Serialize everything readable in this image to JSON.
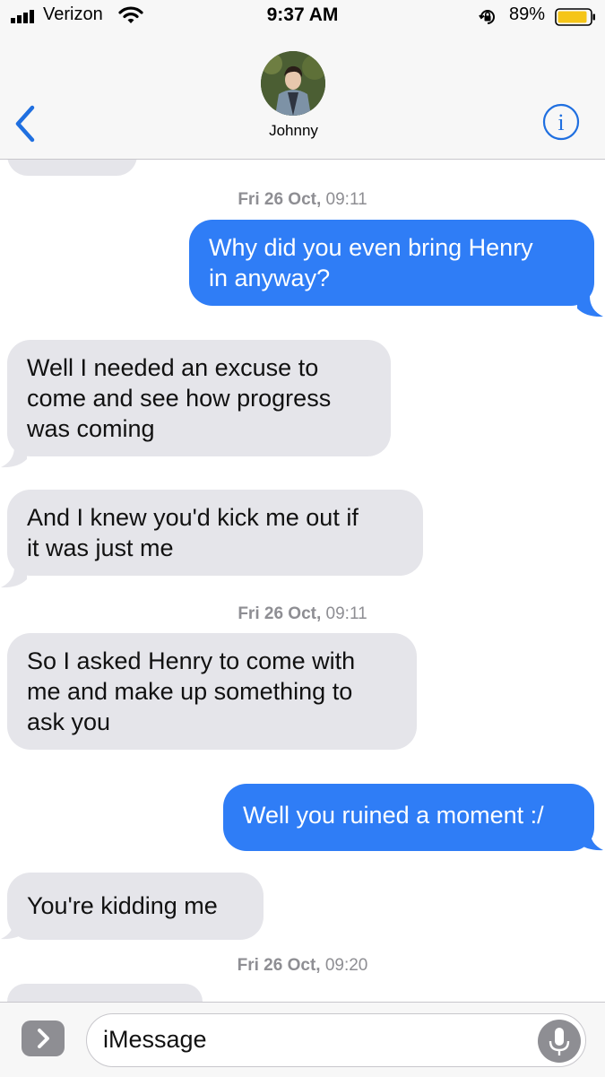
{
  "status_bar": {
    "carrier": "Verizon",
    "time": "9:37 AM",
    "battery_percent": "89%"
  },
  "header": {
    "contact_name": "Johnny"
  },
  "messages": [
    {
      "kind": "timestamp",
      "day": "Fri 26 Oct,",
      "time": "09:11"
    },
    {
      "kind": "outgoing",
      "lines": [
        "Why did you even bring Henry",
        "in anyway?"
      ]
    },
    {
      "kind": "incoming",
      "lines": [
        "Well I needed an excuse to",
        "come and see how progress",
        "was coming"
      ]
    },
    {
      "kind": "incoming",
      "lines": [
        "And I knew you'd kick me out if",
        "it was just me"
      ]
    },
    {
      "kind": "timestamp",
      "day": "Fri 26 Oct,",
      "time": "09:11"
    },
    {
      "kind": "incoming",
      "lines": [
        "So I asked Henry to come with",
        "me and make up something to",
        "ask you"
      ]
    },
    {
      "kind": "outgoing",
      "lines": [
        "Well you ruined a moment :/"
      ]
    },
    {
      "kind": "incoming",
      "lines": [
        "You're kidding me"
      ]
    },
    {
      "kind": "timestamp",
      "day": "Fri 26 Oct,",
      "time": "09:20"
    }
  ],
  "input_bar": {
    "placeholder": "iMessage"
  },
  "colors": {
    "outgoing_bubble": "#2f7df6",
    "incoming_bubble": "#e5e5ea",
    "accent": "#1f6fe0",
    "battery_fill": "#f5c518"
  },
  "icons": [
    "signal-icon",
    "wifi-icon",
    "orientation-lock-icon",
    "battery-icon",
    "back-chevron-icon",
    "info-icon",
    "app-drawer-chevron-icon",
    "microphone-icon"
  ]
}
